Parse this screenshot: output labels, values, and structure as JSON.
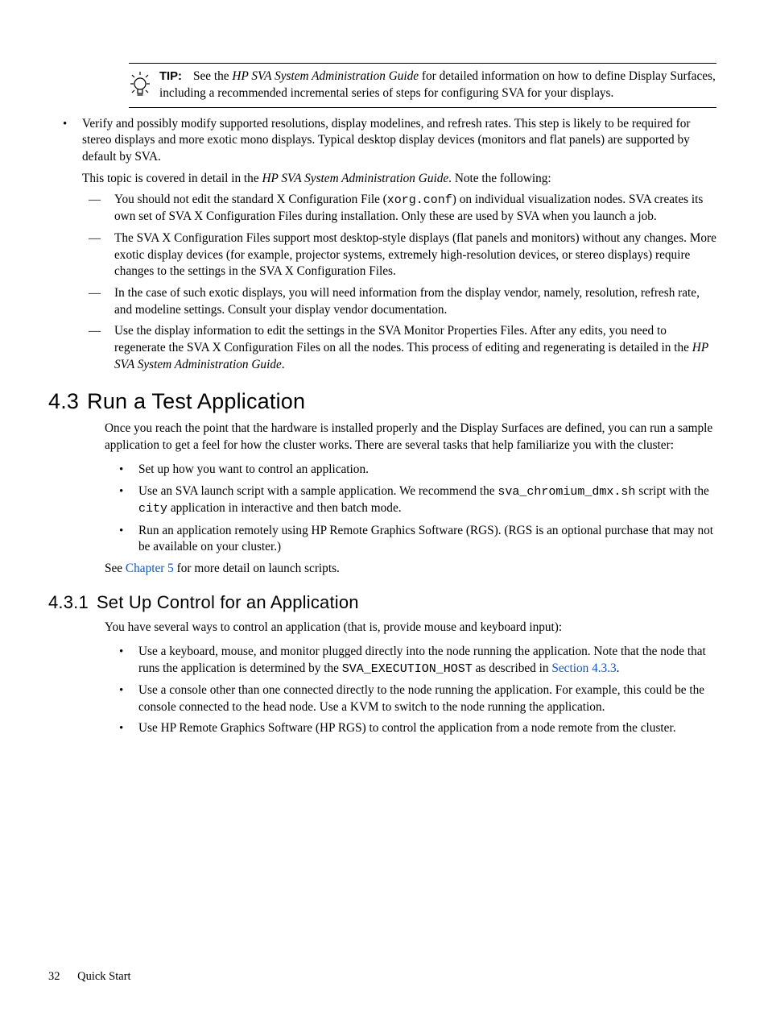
{
  "tip": {
    "label": "TIP:",
    "before": "See the ",
    "doc": "HP SVA System Administration Guide",
    "after": " for detailed information on how to define Display Surfaces, including a recommended incremental series of steps for configuring SVA for your displays."
  },
  "b1": {
    "p1": "Verify and possibly modify supported resolutions, display modelines, and refresh rates. This step is likely to be required for stereo displays and more exotic mono displays. Typical desktop display devices (monitors and flat panels) are supported by default by SVA.",
    "p2a": "This topic is covered in detail in the ",
    "p2doc": "HP SVA System Administration Guide",
    "p2b": ". Note the following:",
    "d1a": "You should not edit the standard X Configuration File (",
    "d1m": "xorg.conf",
    "d1b": ") on individual visualization nodes. SVA creates its own set of SVA X Configuration Files during installation. Only these are used by SVA when you launch a job.",
    "d2": "The SVA X Configuration Files support most desktop-style displays (flat panels and monitors) without any changes. More exotic display devices (for example, projector systems, extremely high-resolution devices, or stereo displays) require changes to the settings in the SVA X Configuration Files.",
    "d3": "In the case of such exotic displays, you will need information from the display vendor, namely, resolution, refresh rate, and modeline settings. Consult your display vendor documentation.",
    "d4a": "Use the display information to edit the settings in the SVA Monitor Properties Files. After any edits, you need to regenerate the SVA X Configuration Files on all the nodes. This process of editing and regenerating is detailed in the ",
    "d4doc": "HP SVA System Administration Guide",
    "d4b": "."
  },
  "s43": {
    "num": "4.3",
    "title": "Run a Test Application",
    "intro": "Once you reach the point that the hardware is installed properly and the Display Surfaces are defined, you can run a sample application to get a feel for how the cluster works. There are several tasks that help familiarize you with the cluster:",
    "li1": "Set up how you want to control an application.",
    "li2a": "Use an SVA launch script with a sample application. We recommend the ",
    "li2m1": "sva_chromium_dmx.sh",
    "li2b": " script with the ",
    "li2m2": "city",
    "li2c": " application in interactive and then batch mode.",
    "li3": "Run an application remotely using HP Remote Graphics Software (RGS). (RGS is an optional purchase that may not be available on your cluster.)",
    "seea": "See ",
    "seelink": "Chapter 5",
    "seeb": " for more detail on launch scripts."
  },
  "s431": {
    "num": "4.3.1",
    "title": "Set Up Control for an Application",
    "intro": "You have several ways to control an application (that is, provide mouse and keyboard input):",
    "li1a": "Use a keyboard, mouse, and monitor plugged directly into the node running the application. Note that the node that runs the application is determined by the ",
    "li1m": "SVA_EXECUTION_HOST",
    "li1b": " as described in ",
    "li1link": "Section 4.3.3",
    "li1c": ".",
    "li2": "Use a console other than one connected directly to the node running the application. For example, this could be the console connected to the head node. Use a KVM to switch to the node running the application.",
    "li3": "Use HP Remote Graphics Software (HP RGS) to control the application from a node remote from the cluster."
  },
  "footer": {
    "page": "32",
    "title": "Quick Start"
  }
}
